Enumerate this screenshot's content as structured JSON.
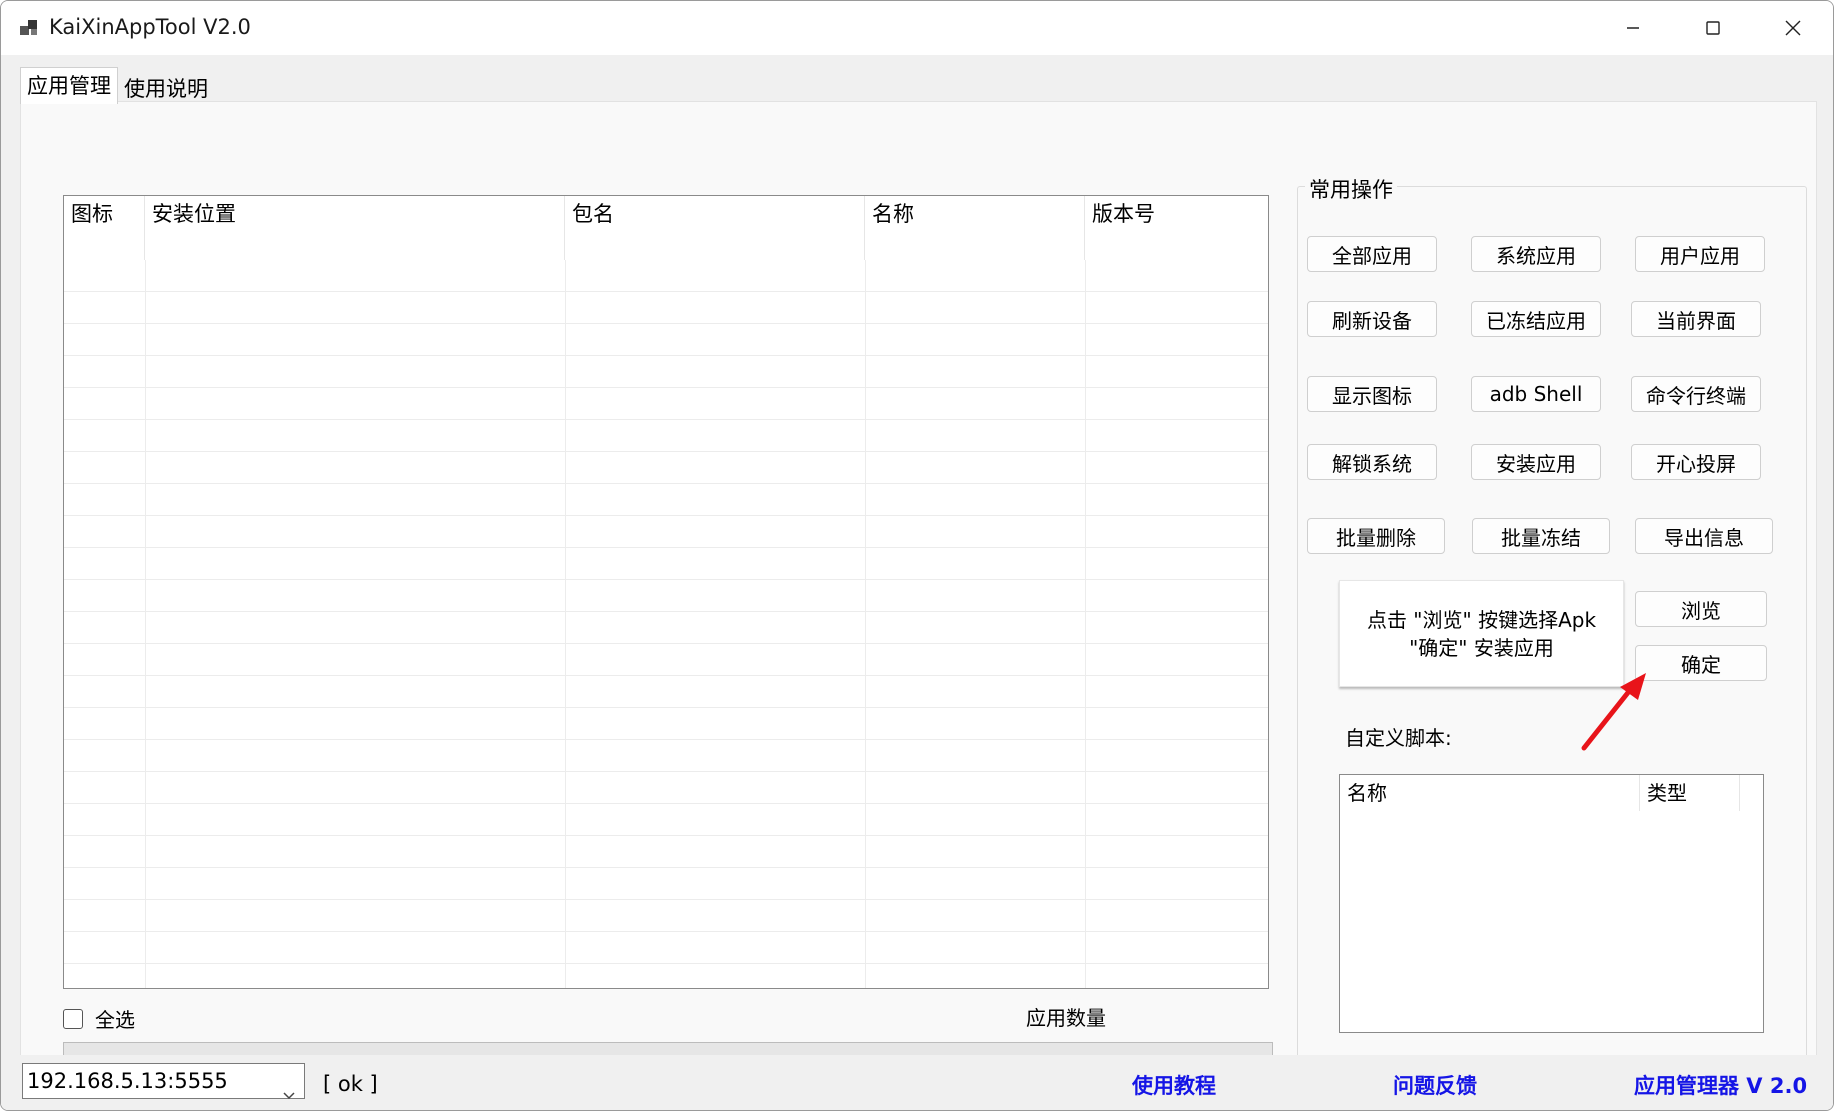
{
  "window": {
    "title": "KaiXinAppTool V2.0",
    "icons": [
      "app-icon",
      "minimize-icon",
      "maximize-icon",
      "close-icon"
    ]
  },
  "tabs": [
    {
      "label": "应用管理",
      "active": true
    },
    {
      "label": "使用说明",
      "active": false
    }
  ],
  "app_list": {
    "columns": [
      "图标",
      "安装位置",
      "包名",
      "名称",
      "版本号"
    ],
    "rows": []
  },
  "select_all_label": "全选",
  "app_count_label": "应用数量",
  "progress": {
    "value": 0
  },
  "operations": {
    "title": "常用操作",
    "buttons": [
      "全部应用",
      "系统应用",
      "用户应用",
      "刷新设备",
      "已冻结应用",
      "当前界面",
      "显示图标",
      "adb Shell",
      "命令行终端",
      "解锁系统",
      "安装应用",
      "开心投屏",
      "批量删除",
      "批量冻结",
      "导出信息"
    ],
    "install_hint": {
      "line1": "点击 \"浏览\" 按键选择Apk",
      "line2": "\"确定\" 安装应用"
    },
    "browse_label": "浏览",
    "confirm_label": "确定"
  },
  "custom_scripts": {
    "label": "自定义脚本:",
    "columns": [
      "名称",
      "类型"
    ]
  },
  "status_bar": {
    "device": "192.168.5.13:5555",
    "status": "[ ok ]",
    "links": [
      "使用教程",
      "问题反馈",
      "应用管理器 V 2.0"
    ]
  },
  "colors": {
    "link": "#1515e6",
    "arrow": "#e8141a",
    "background": "#f0f0f0"
  }
}
